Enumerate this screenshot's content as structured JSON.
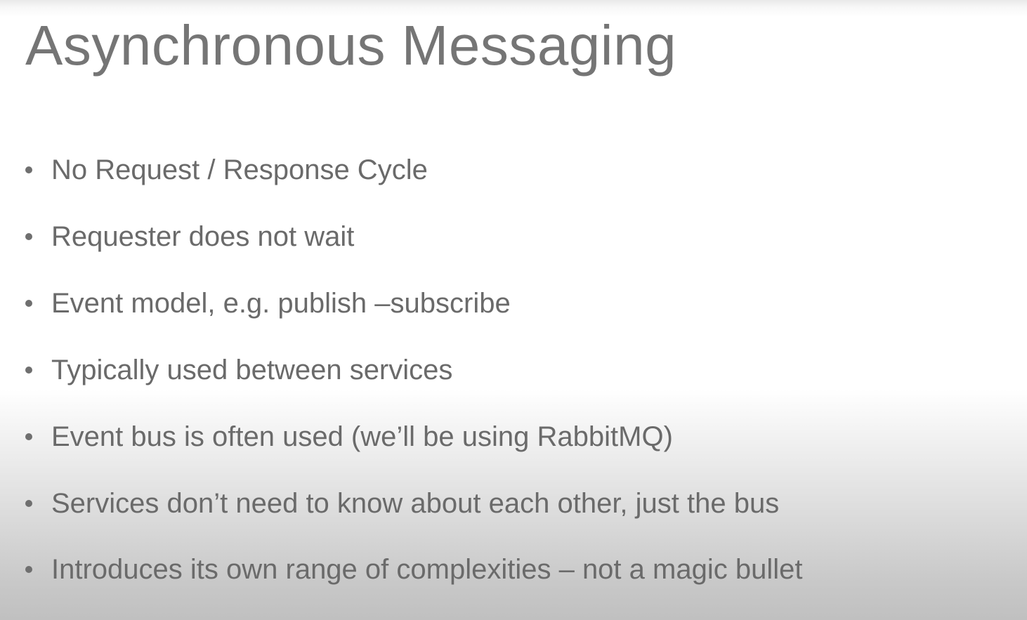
{
  "slide": {
    "title": "Asynchronous Messaging",
    "bullets": [
      "No Request / Response Cycle",
      "Requester does not wait",
      "Event model, e.g. publish –subscribe",
      "Typically used between services",
      "Event bus is often used (we’ll be using RabbitMQ)",
      "Services don’t need to know about each other, just the bus",
      "Introduces its own range of complexities – not a magic bullet"
    ]
  },
  "colors": {
    "title_text": "#757575",
    "body_text": "#6a6a6a",
    "background_top": "#ffffff",
    "background_bottom": "#c0c0c0"
  }
}
